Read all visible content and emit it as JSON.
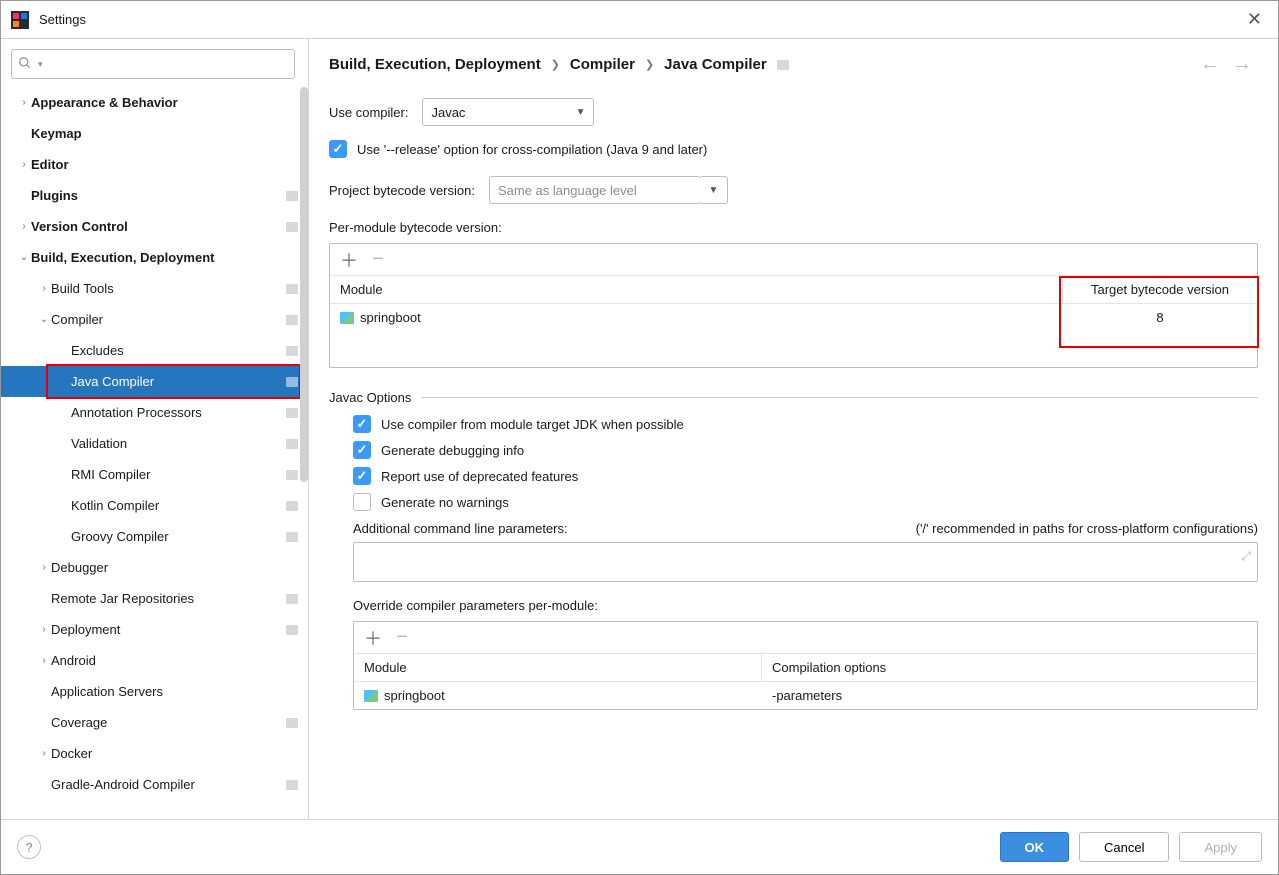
{
  "window_title": "Settings",
  "breadcrumb": [
    "Build, Execution, Deployment",
    "Compiler",
    "Java Compiler"
  ],
  "sidebar": {
    "items": [
      {
        "label": "Appearance & Behavior",
        "bold": true,
        "indent": 1,
        "chev": "right"
      },
      {
        "label": "Keymap",
        "bold": true,
        "indent": 1
      },
      {
        "label": "Editor",
        "bold": true,
        "indent": 1,
        "chev": "right"
      },
      {
        "label": "Plugins",
        "bold": true,
        "indent": 1,
        "badge": true
      },
      {
        "label": "Version Control",
        "bold": true,
        "indent": 1,
        "chev": "right",
        "badge": true
      },
      {
        "label": "Build, Execution, Deployment",
        "bold": true,
        "indent": 1,
        "chev": "down"
      },
      {
        "label": "Build Tools",
        "indent": 2,
        "chev": "right",
        "badge": true
      },
      {
        "label": "Compiler",
        "indent": 2,
        "chev": "down",
        "badge": true
      },
      {
        "label": "Excludes",
        "indent": 3,
        "badge": true
      },
      {
        "label": "Java Compiler",
        "indent": 3,
        "badge": true,
        "selected": true,
        "highlight": true
      },
      {
        "label": "Annotation Processors",
        "indent": 3,
        "badge": true
      },
      {
        "label": "Validation",
        "indent": 3,
        "badge": true
      },
      {
        "label": "RMI Compiler",
        "indent": 3,
        "badge": true
      },
      {
        "label": "Kotlin Compiler",
        "indent": 3,
        "badge": true
      },
      {
        "label": "Groovy Compiler",
        "indent": 3,
        "badge": true
      },
      {
        "label": "Debugger",
        "indent": 2,
        "chev": "right"
      },
      {
        "label": "Remote Jar Repositories",
        "indent": 2,
        "badge": true
      },
      {
        "label": "Deployment",
        "indent": 2,
        "chev": "right",
        "badge": true
      },
      {
        "label": "Android",
        "indent": 2,
        "chev": "right"
      },
      {
        "label": "Application Servers",
        "indent": 2
      },
      {
        "label": "Coverage",
        "indent": 2,
        "badge": true
      },
      {
        "label": "Docker",
        "indent": 2,
        "chev": "right"
      },
      {
        "label": "Gradle-Android Compiler",
        "indent": 2,
        "badge": true
      }
    ]
  },
  "form": {
    "use_compiler_label": "Use compiler:",
    "use_compiler_value": "Javac",
    "release_option": "Use '--release' option for cross-compilation (Java 9 and later)",
    "project_bytecode_label": "Project bytecode version:",
    "project_bytecode_value": "Same as language level",
    "per_module_label": "Per-module bytecode version:",
    "table1_headers": {
      "module": "Module",
      "target": "Target bytecode version"
    },
    "table1_row": {
      "module": "springboot",
      "target": "8"
    },
    "javac_options_title": "Javac Options",
    "opt1": "Use compiler from module target JDK when possible",
    "opt2": "Generate debugging info",
    "opt3": "Report use of deprecated features",
    "opt4": "Generate no warnings",
    "additional_label": "Additional command line parameters:",
    "additional_hint": "('/' recommended in paths for cross-platform configurations)",
    "override_label": "Override compiler parameters per-module:",
    "table2_headers": {
      "module": "Module",
      "options": "Compilation options"
    },
    "table2_row": {
      "module": "springboot",
      "options": "-parameters"
    }
  },
  "footer": {
    "ok": "OK",
    "cancel": "Cancel",
    "apply": "Apply"
  }
}
